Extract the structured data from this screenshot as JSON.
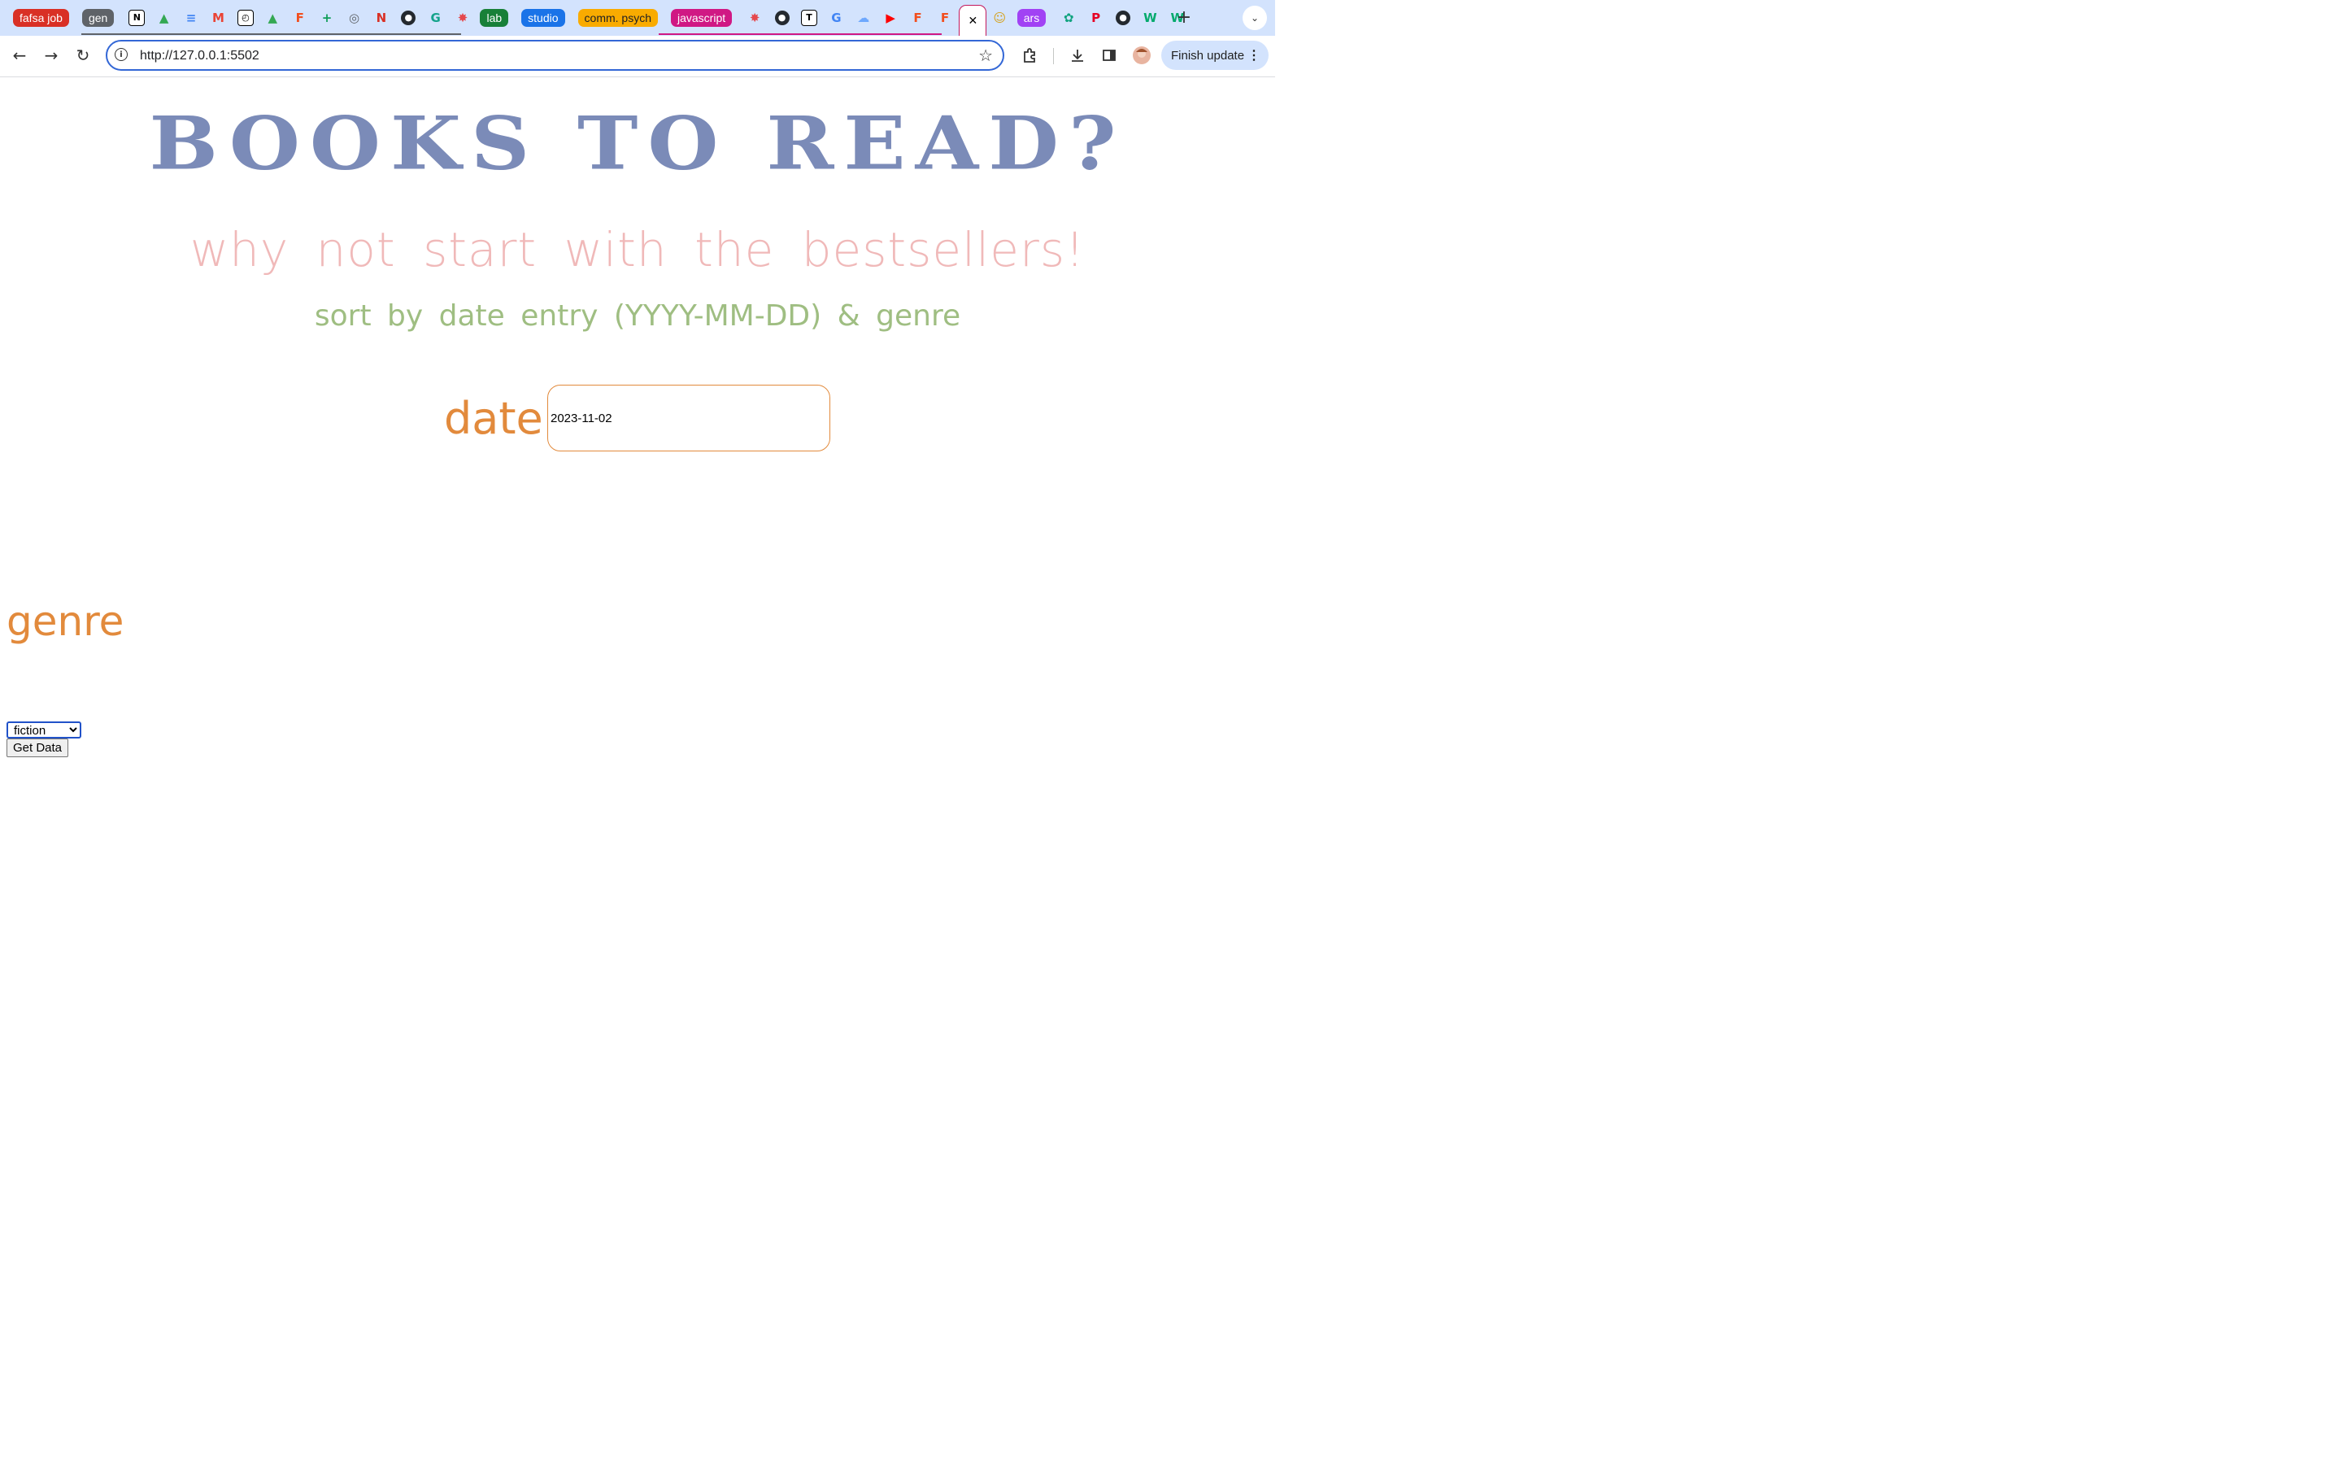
{
  "browser": {
    "tabs": [
      {
        "kind": "group",
        "label": "fafsa job",
        "color": "#d93025"
      },
      {
        "kind": "group",
        "label": "gen",
        "color": "#5f6368"
      },
      {
        "kind": "favicon",
        "icon": "notion-icon"
      },
      {
        "kind": "favicon",
        "icon": "google-drive-icon"
      },
      {
        "kind": "favicon",
        "icon": "google-docs-icon"
      },
      {
        "kind": "favicon",
        "icon": "gmail-icon"
      },
      {
        "kind": "favicon",
        "icon": "timer-icon"
      },
      {
        "kind": "favicon",
        "icon": "google-drive-icon"
      },
      {
        "kind": "favicon",
        "icon": "figma-icon"
      },
      {
        "kind": "favicon",
        "icon": "google-sheets-icon"
      },
      {
        "kind": "favicon",
        "icon": "globe-icon"
      },
      {
        "kind": "favicon",
        "icon": "n-app-icon"
      },
      {
        "kind": "favicon",
        "icon": "github-icon"
      },
      {
        "kind": "favicon",
        "icon": "grammarly-icon"
      },
      {
        "kind": "favicon",
        "icon": "wheel-icon"
      },
      {
        "kind": "group",
        "label": "lab",
        "color": "#188038"
      },
      {
        "kind": "group",
        "label": "studio",
        "color": "#1a73e8"
      },
      {
        "kind": "group",
        "label": "comm. psych",
        "color": "#f9ab00",
        "text_color": "#202124"
      },
      {
        "kind": "group",
        "label": "javascript",
        "color": "#d01884"
      },
      {
        "kind": "favicon",
        "icon": "wheel-icon"
      },
      {
        "kind": "favicon",
        "icon": "github-icon"
      },
      {
        "kind": "favicon",
        "icon": "nytimes-icon"
      },
      {
        "kind": "favicon",
        "icon": "google-icon"
      },
      {
        "kind": "favicon",
        "icon": "cloud-icon"
      },
      {
        "kind": "favicon",
        "icon": "youtube-icon"
      },
      {
        "kind": "favicon",
        "icon": "figma-icon"
      },
      {
        "kind": "favicon",
        "icon": "figma-icon"
      },
      {
        "kind": "active",
        "icon": "close-icon"
      },
      {
        "kind": "favicon",
        "icon": "character-icon"
      },
      {
        "kind": "group",
        "label": "ars",
        "color": "#a142f4"
      },
      {
        "kind": "favicon",
        "icon": "openai-icon"
      },
      {
        "kind": "favicon",
        "icon": "pinterest-icon"
      },
      {
        "kind": "favicon",
        "icon": "github-icon"
      },
      {
        "kind": "favicon",
        "icon": "w3schools-icon"
      },
      {
        "kind": "favicon",
        "icon": "w3schools-icon"
      }
    ],
    "url": "http://127.0.0.1:5502",
    "finish_update_label": "Finish update"
  },
  "page": {
    "title": "BOOKS TO READ?",
    "subtitle": "why not start with the bestsellers!",
    "instruction": "sort by date entry (YYYY-MM-DD) & genre",
    "date_label": "date",
    "date_value": "2023-11-02",
    "genre_label": "genre",
    "genre_selected": "fiction",
    "button_label": "Get Data"
  },
  "colors": {
    "title": "#7b8bb8",
    "subtitle": "#f0b9b9",
    "instruction": "#9fbe82",
    "labels": "#e28a3c"
  }
}
